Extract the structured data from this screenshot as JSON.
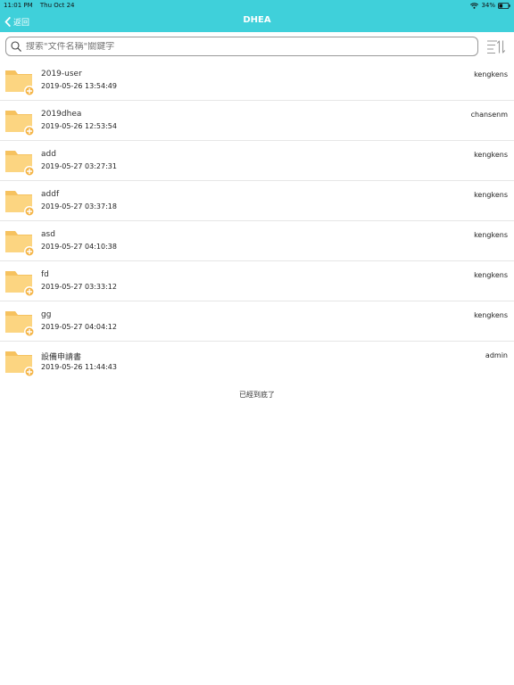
{
  "status_bar": {
    "time": "11:01 PM",
    "date": "Thu Oct 24",
    "battery": "34%"
  },
  "nav": {
    "back_label": "返回",
    "title": "DHEA"
  },
  "search": {
    "placeholder": "搜索\"文件名稱\"關鍵字"
  },
  "colors": {
    "accent": "#3fd0da",
    "folder": "#fcd581",
    "folder_tab": "#f6c25f",
    "badge": "#f5b547"
  },
  "files": [
    {
      "name": "2019-user",
      "date": "2019-05-26 13:54:49",
      "owner": "kengkens"
    },
    {
      "name": "2019dhea",
      "date": "2019-05-26 12:53:54",
      "owner": "chansenm"
    },
    {
      "name": "add",
      "date": "2019-05-27 03:27:31",
      "owner": "kengkens"
    },
    {
      "name": "addf",
      "date": "2019-05-27 03:37:18",
      "owner": "kengkens"
    },
    {
      "name": "asd",
      "date": "2019-05-27 04:10:38",
      "owner": "kengkens"
    },
    {
      "name": "fd",
      "date": "2019-05-27 03:33:12",
      "owner": "kengkens"
    },
    {
      "name": "gg",
      "date": "2019-05-27 04:04:12",
      "owner": "kengkens"
    },
    {
      "name": "設備申請書",
      "date": "2019-05-26 11:44:43",
      "owner": "admin"
    }
  ],
  "list_end_text": "已經到底了"
}
